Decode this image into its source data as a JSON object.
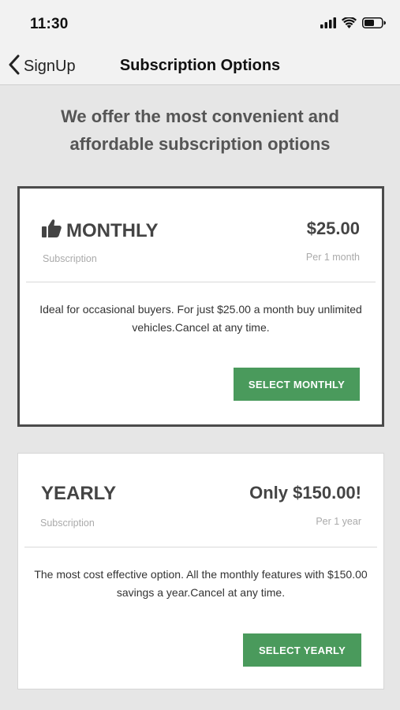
{
  "status_bar": {
    "time": "11:30",
    "icons": [
      "signal-icon",
      "wifi-icon",
      "battery-icon"
    ]
  },
  "nav": {
    "back_label": "SignUp",
    "title": "Subscription Options"
  },
  "headline": "We offer the most convenient and affordable subscription options",
  "colors": {
    "accent_button": "#4a9a5c",
    "selected_border": "#4b4b4b",
    "background": "#e6e6e6"
  },
  "plans": [
    {
      "name": "MONTHLY",
      "icon": "thumbs-up-icon",
      "subtitle": "Subscription",
      "price": "$25.00",
      "period": "Per 1 month",
      "description": "Ideal for occasional buyers. For just $25.00 a month buy unlimited vehicles.Cancel at any time.",
      "button_label": "SELECT MONTHLY",
      "selected": true
    },
    {
      "name": "YEARLY",
      "subtitle": "Subscription",
      "price": "Only $150.00!",
      "period": "Per 1 year",
      "description": "The most cost effective option. All the monthly features with $150.00 savings a year.Cancel at any time.",
      "button_label": "SELECT YEARLY",
      "selected": false
    }
  ]
}
